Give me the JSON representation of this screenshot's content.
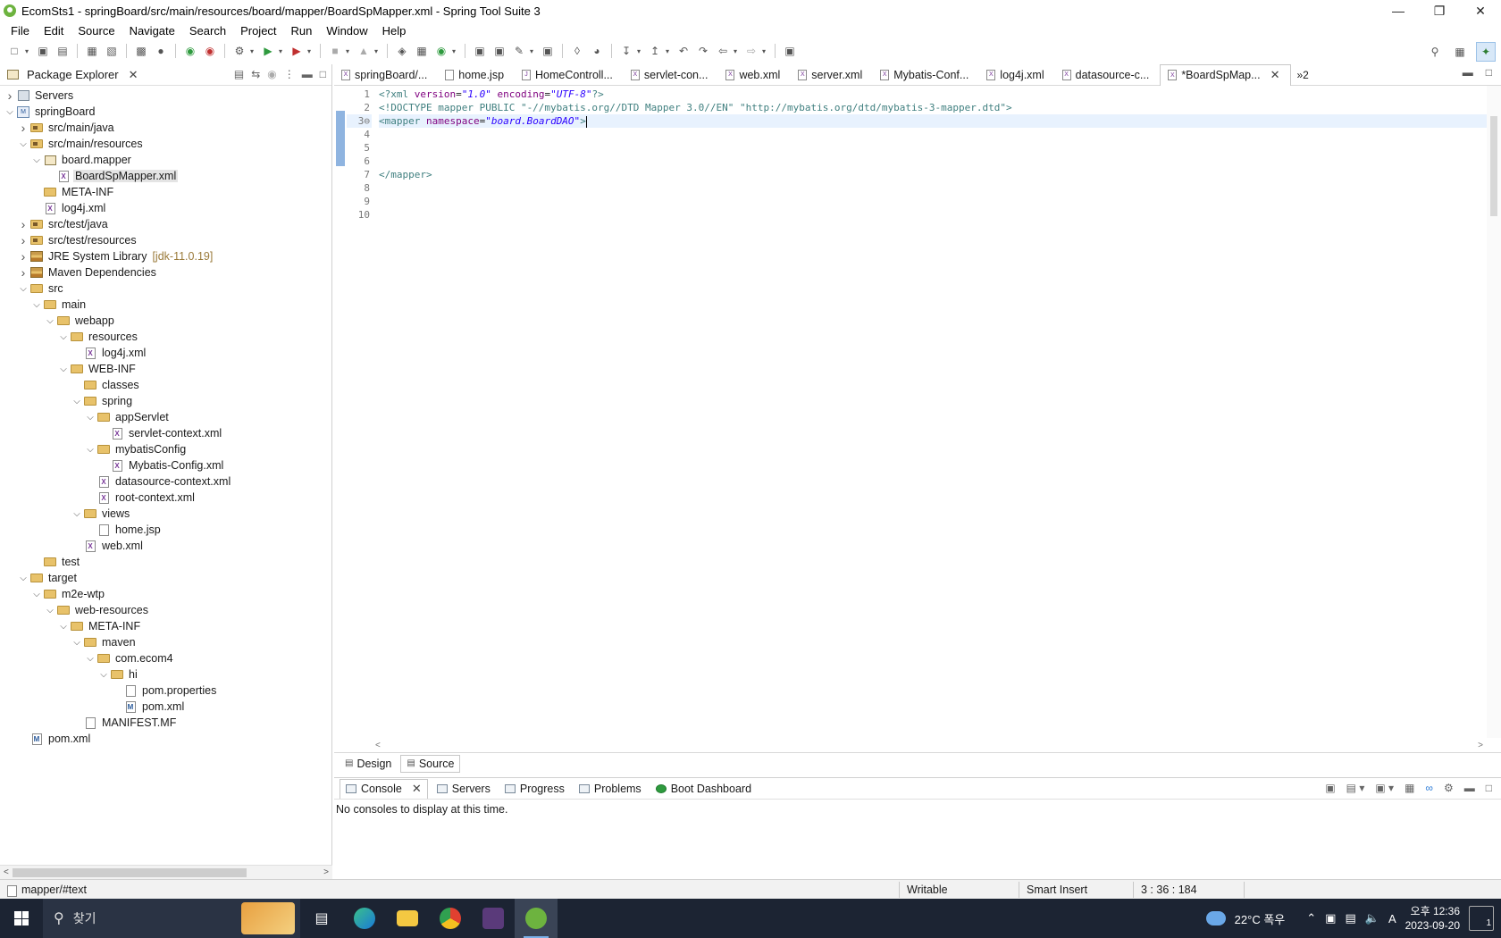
{
  "window": {
    "title": "EcomSts1 - springBoard/src/main/resources/board/mapper/BoardSpMapper.xml - Spring Tool Suite 3",
    "minimize": "—",
    "restore": "❐",
    "close": "✕"
  },
  "menu": [
    "File",
    "Edit",
    "Source",
    "Navigate",
    "Search",
    "Project",
    "Run",
    "Window",
    "Help"
  ],
  "package_explorer": {
    "title": "Package Explorer",
    "tree": [
      {
        "label": "Servers",
        "depth": 0,
        "twisty": "right",
        "icon": "server"
      },
      {
        "label": "springBoard",
        "depth": 0,
        "twisty": "down",
        "icon": "project"
      },
      {
        "label": "src/main/java",
        "depth": 1,
        "twisty": "right",
        "icon": "srcfolder"
      },
      {
        "label": "src/main/resources",
        "depth": 1,
        "twisty": "down",
        "icon": "srcfolder"
      },
      {
        "label": "board.mapper",
        "depth": 2,
        "twisty": "down",
        "icon": "package"
      },
      {
        "label": "BoardSpMapper.xml",
        "depth": 3,
        "twisty": "",
        "icon": "xml",
        "selected": true
      },
      {
        "label": "META-INF",
        "depth": 2,
        "twisty": "",
        "icon": "folder"
      },
      {
        "label": "log4j.xml",
        "depth": 2,
        "twisty": "",
        "icon": "xml"
      },
      {
        "label": "src/test/java",
        "depth": 1,
        "twisty": "right",
        "icon": "srcfolder"
      },
      {
        "label": "src/test/resources",
        "depth": 1,
        "twisty": "right",
        "icon": "srcfolder"
      },
      {
        "label": "JRE System Library",
        "suffix": "[jdk-11.0.19]",
        "depth": 1,
        "twisty": "right",
        "icon": "library"
      },
      {
        "label": "Maven Dependencies",
        "depth": 1,
        "twisty": "right",
        "icon": "library"
      },
      {
        "label": "src",
        "depth": 1,
        "twisty": "down",
        "icon": "folder"
      },
      {
        "label": "main",
        "depth": 2,
        "twisty": "down",
        "icon": "folder"
      },
      {
        "label": "webapp",
        "depth": 3,
        "twisty": "down",
        "icon": "folder"
      },
      {
        "label": "resources",
        "depth": 4,
        "twisty": "down",
        "icon": "folder"
      },
      {
        "label": "log4j.xml",
        "depth": 5,
        "twisty": "",
        "icon": "xml"
      },
      {
        "label": "WEB-INF",
        "depth": 4,
        "twisty": "down",
        "icon": "folder"
      },
      {
        "label": "classes",
        "depth": 5,
        "twisty": "",
        "icon": "folder"
      },
      {
        "label": "spring",
        "depth": 5,
        "twisty": "down",
        "icon": "folder"
      },
      {
        "label": "appServlet",
        "depth": 6,
        "twisty": "down",
        "icon": "folder"
      },
      {
        "label": "servlet-context.xml",
        "depth": 7,
        "twisty": "",
        "icon": "xml"
      },
      {
        "label": "mybatisConfig",
        "depth": 6,
        "twisty": "down",
        "icon": "folder"
      },
      {
        "label": "Mybatis-Config.xml",
        "depth": 7,
        "twisty": "",
        "icon": "xml"
      },
      {
        "label": "datasource-context.xml",
        "depth": 6,
        "twisty": "",
        "icon": "xml"
      },
      {
        "label": "root-context.xml",
        "depth": 6,
        "twisty": "",
        "icon": "xml"
      },
      {
        "label": "views",
        "depth": 5,
        "twisty": "down",
        "icon": "folder"
      },
      {
        "label": "home.jsp",
        "depth": 6,
        "twisty": "",
        "icon": "jsp"
      },
      {
        "label": "web.xml",
        "depth": 5,
        "twisty": "",
        "icon": "xml"
      },
      {
        "label": "test",
        "depth": 2,
        "twisty": "",
        "icon": "folder"
      },
      {
        "label": "target",
        "depth": 1,
        "twisty": "down",
        "icon": "folder"
      },
      {
        "label": "m2e-wtp",
        "depth": 2,
        "twisty": "down",
        "icon": "folder"
      },
      {
        "label": "web-resources",
        "depth": 3,
        "twisty": "down",
        "icon": "folder"
      },
      {
        "label": "META-INF",
        "depth": 4,
        "twisty": "down",
        "icon": "folder"
      },
      {
        "label": "maven",
        "depth": 5,
        "twisty": "down",
        "icon": "folder"
      },
      {
        "label": "com.ecom4",
        "depth": 6,
        "twisty": "down",
        "icon": "folder"
      },
      {
        "label": "hi",
        "depth": 7,
        "twisty": "down",
        "icon": "folder"
      },
      {
        "label": "pom.properties",
        "depth": 8,
        "twisty": "",
        "icon": "text"
      },
      {
        "label": "pom.xml",
        "depth": 8,
        "twisty": "",
        "icon": "pom"
      },
      {
        "label": "MANIFEST.MF",
        "depth": 5,
        "twisty": "",
        "icon": "text"
      },
      {
        "label": "pom.xml",
        "depth": 1,
        "twisty": "",
        "icon": "pom"
      }
    ]
  },
  "editor": {
    "tabs": [
      {
        "label": "springBoard/...",
        "icon": "xml"
      },
      {
        "label": "home.jsp",
        "icon": "jsp"
      },
      {
        "label": "HomeControll...",
        "icon": "java"
      },
      {
        "label": "servlet-con...",
        "icon": "xml"
      },
      {
        "label": "web.xml",
        "icon": "xml"
      },
      {
        "label": "server.xml",
        "icon": "xml"
      },
      {
        "label": "Mybatis-Conf...",
        "icon": "xml"
      },
      {
        "label": "log4j.xml",
        "icon": "xml"
      },
      {
        "label": "datasource-c...",
        "icon": "xml"
      },
      {
        "label": "*BoardSpMap...",
        "icon": "xml",
        "active": true
      }
    ],
    "more_tabs": "»2",
    "line_numbers": [
      "1",
      "2",
      "3⊖",
      "4",
      "5",
      "6",
      "7",
      "8",
      "9",
      "10"
    ],
    "code": {
      "line1": {
        "open": "<?xml ",
        "a1": "version",
        "eq1": "=",
        "v1": "\"1.0\"",
        "a2": " encoding",
        "eq2": "=",
        "v2": "\"UTF-8\"",
        "close": "?>"
      },
      "line2": {
        "text": "<!DOCTYPE mapper PUBLIC \"-//mybatis.org//DTD Mapper 3.0//EN\" \"http://mybatis.org/dtd/mybatis-3-mapper.dtd\">"
      },
      "line3": {
        "open": "<mapper ",
        "attr": "namespace",
        "eq": "=",
        "val": "\"board.BoardDAO\"",
        "close": ">"
      },
      "line7": {
        "text": "</mapper>"
      }
    },
    "bottom_tabs": [
      "Design",
      "Source"
    ]
  },
  "console": {
    "tabs": [
      "Console",
      "Servers",
      "Progress",
      "Problems",
      "Boot Dashboard"
    ],
    "message": "No consoles to display at this time."
  },
  "status": {
    "path": "mapper/#text",
    "writable": "Writable",
    "insert_mode": "Smart Insert",
    "position": "3 : 36 : 184"
  },
  "taskbar": {
    "search_placeholder": "찾기",
    "weather": "22°C 폭우",
    "time": "오후 12:36",
    "date": "2023-09-20",
    "notifications": "1",
    "ime": "A"
  }
}
